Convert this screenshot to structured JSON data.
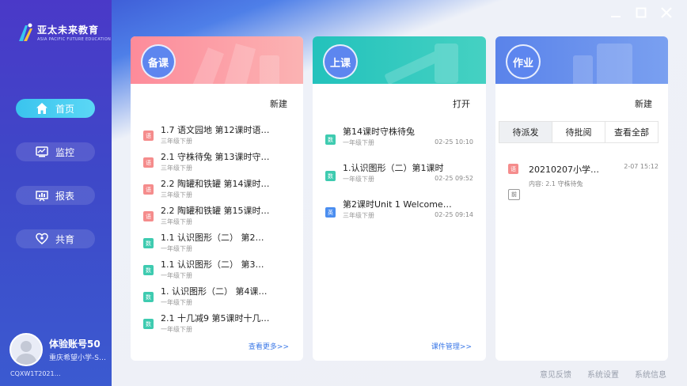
{
  "brand": {
    "title": "亚太未来教育",
    "subtitle": "ASIA PACIFIC FUTURE EDUCATION"
  },
  "nav": [
    {
      "label": "首页",
      "icon": "home-icon",
      "active": true
    },
    {
      "label": "监控",
      "icon": "monitor-icon",
      "active": false
    },
    {
      "label": "报表",
      "icon": "report-icon",
      "active": false
    },
    {
      "label": "共育",
      "icon": "co-education-icon",
      "active": false
    }
  ],
  "user": {
    "name": "体验账号50",
    "school": "重庆希望小学-S…",
    "code": "CQXW1T2021…"
  },
  "window": {
    "minimize": "—",
    "maximize": "☐",
    "close": "✕"
  },
  "prep": {
    "title": "备课",
    "action": "新建",
    "more": "查看更多>>",
    "items": [
      {
        "badge": "语",
        "title": "1.7 语文园地 第12课时语…",
        "sub": "三年级下册"
      },
      {
        "badge": "语",
        "title": "2.1 守株待兔 第13课时守…",
        "sub": "三年级下册"
      },
      {
        "badge": "语",
        "title": "2.2 陶罐和铁罐 第14课时…",
        "sub": "三年级下册"
      },
      {
        "badge": "语",
        "title": "2.2 陶罐和铁罐 第15课时…",
        "sub": "三年级下册"
      },
      {
        "badge": "数",
        "title": "1.1 认识图形（二） 第2…",
        "sub": "一年级下册"
      },
      {
        "badge": "数",
        "title": "1.1 认识图形（二） 第3…",
        "sub": "一年级下册"
      },
      {
        "badge": "数",
        "title": "1. 认识图形（二） 第4课…",
        "sub": "一年级下册"
      },
      {
        "badge": "数",
        "title": "2.1 十几减9 第5课时十几…",
        "sub": "一年级下册"
      }
    ]
  },
  "class": {
    "title": "上课",
    "action": "打开",
    "more": "课件管理>>",
    "items": [
      {
        "badge": "数",
        "title": "第14课时守株待兔",
        "sub": "一年级下册",
        "time": "02-25 10:10"
      },
      {
        "badge": "数",
        "title": "1.认识图形（二）第1课时",
        "sub": "一年级下册",
        "time": "02-25 09:52"
      },
      {
        "badge": "英",
        "title": "第2课时Unit 1 Welcome…",
        "sub": "三年级下册",
        "time": "02-25 09:14"
      }
    ]
  },
  "homework": {
    "title": "作业",
    "action": "新建",
    "tabs": [
      "待派发",
      "待批阅",
      "查看全部"
    ],
    "item": {
      "badge": "语",
      "title": "20210207小学…",
      "time": "2-07 15:12",
      "content": "内容:  2.1 守株待兔",
      "tag": "前"
    }
  },
  "footer": [
    "意见反馈",
    "系统设置",
    "系统信息"
  ],
  "colors": {
    "prep": "#fb8c9c",
    "class": "#2fc7c2",
    "homework": "#5f88ea"
  }
}
